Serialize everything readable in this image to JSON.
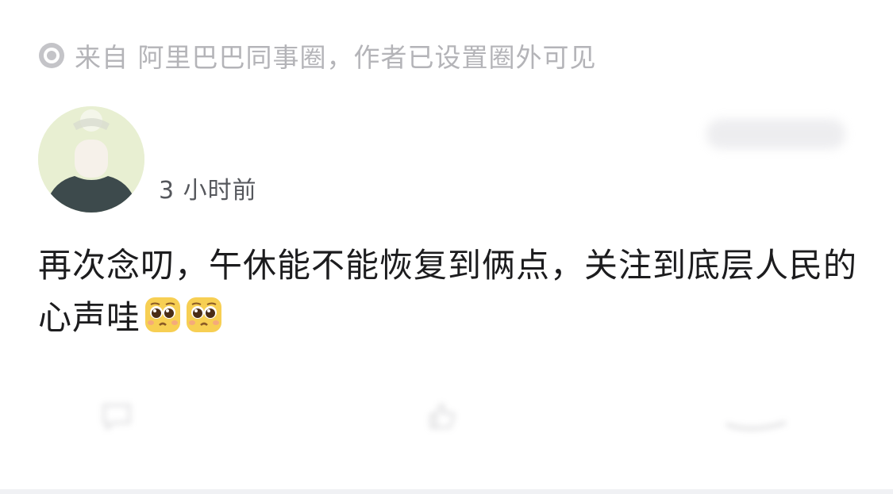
{
  "source": {
    "icon": "source-circle-icon",
    "text": "来自 阿里巴巴同事圈，作者已设置圈外可见"
  },
  "author": {
    "name": "",
    "time": "3 小时前"
  },
  "post": {
    "text": "再次念叨，午休能不能恢复到俩点，关注到底层人民的心声哇",
    "emojis": [
      "pleading-face-emoji",
      "pleading-face-emoji"
    ]
  },
  "actions": {
    "comment": "comment-icon",
    "like": "like-icon",
    "share": "share-icon"
  },
  "colors": {
    "source_text": "#b4b4b8",
    "time_text": "#55575c",
    "body_text": "#1c1c1e",
    "emoji_yellow": "#f7cf53"
  }
}
